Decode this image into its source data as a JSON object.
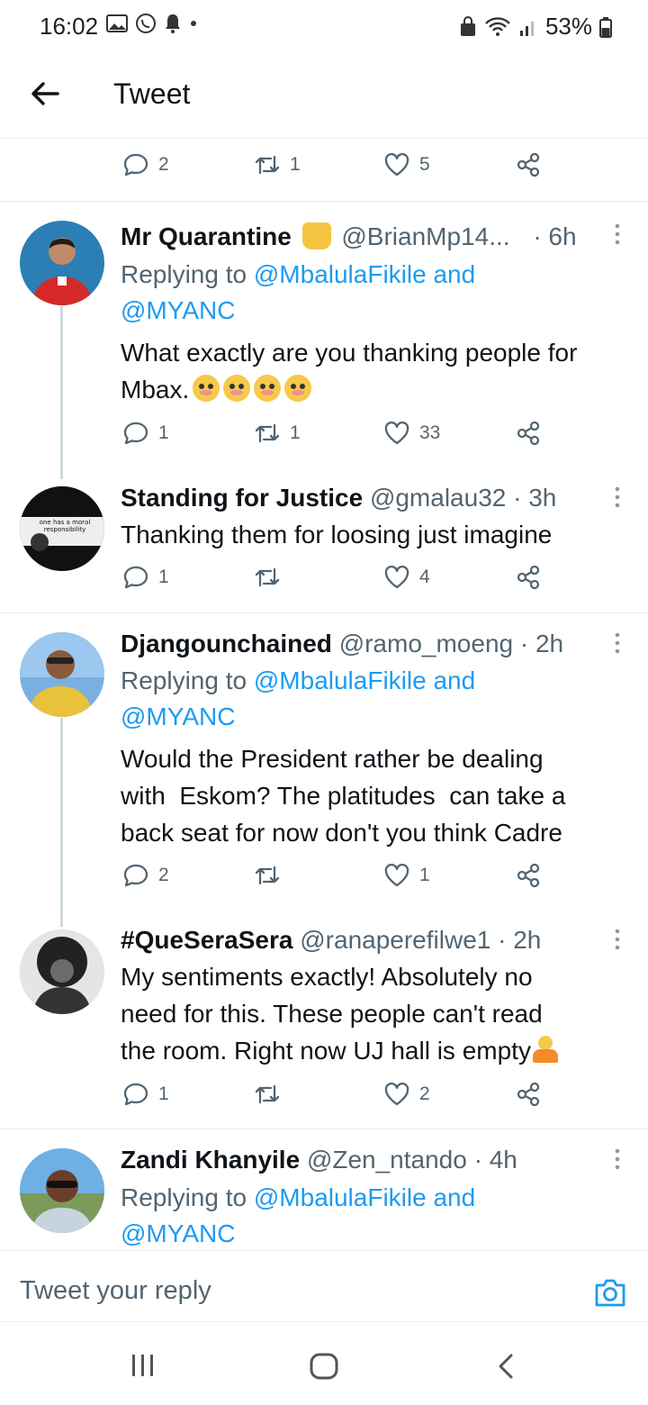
{
  "status_bar": {
    "time": "16:02",
    "battery": "53%"
  },
  "header": {
    "title": "Tweet"
  },
  "top_actions": {
    "replies": "2",
    "retweets": "1",
    "likes": "5"
  },
  "tweets": [
    {
      "name": "Mr Quarantine",
      "handle": "@BrianMp14...",
      "time": "· 6h",
      "replying_prefix": "Replying to ",
      "replying_line1": "@MbalulaFikile and",
      "replying_line2": "@MYANC",
      "text_line1": "What exactly are you thanking people for",
      "text_line2": "Mbax.",
      "replies": "1",
      "retweets": "1",
      "likes": "33"
    },
    {
      "name": "Standing for Justice",
      "handle": "@gmalau32",
      "time": "· 3h",
      "text_line1": "Thanking them for loosing just imagine",
      "replies": "1",
      "retweets": "",
      "likes": "4"
    },
    {
      "name": "Djangounchained",
      "handle": "@ramo_moeng",
      "time": "· 2h",
      "replying_prefix": "Replying to ",
      "replying_line1": "@MbalulaFikile and",
      "replying_line2": "@MYANC",
      "text_line1": "Would the President rather be dealing",
      "text_line2": "with  Eskom? The platitudes  can take a",
      "text_line3": "back seat for now don't you think Cadre",
      "replies": "2",
      "retweets": "",
      "likes": "1"
    },
    {
      "name": "#QueSeraSera",
      "handle": "@ranaperefilwe1",
      "time": "· 2h",
      "text_line1": "My sentiments exactly! Absolutely no",
      "text_line2": "need for this. These people can't read",
      "text_line3": "the room. Right now UJ hall is empty",
      "replies": "1",
      "retweets": "",
      "likes": "2"
    },
    {
      "name": "Zandi Khanyile",
      "handle": "@Zen_ntando",
      "time": "· 4h",
      "replying_prefix": "Replying to ",
      "replying_line1": "@MbalulaFikile and",
      "replying_line2": "@MYANC"
    }
  ],
  "composer": {
    "placeholder": "Tweet your reply"
  },
  "colors": {
    "accent": "#1d9bf0",
    "muted": "#536471",
    "divider": "#e6ecf0"
  }
}
